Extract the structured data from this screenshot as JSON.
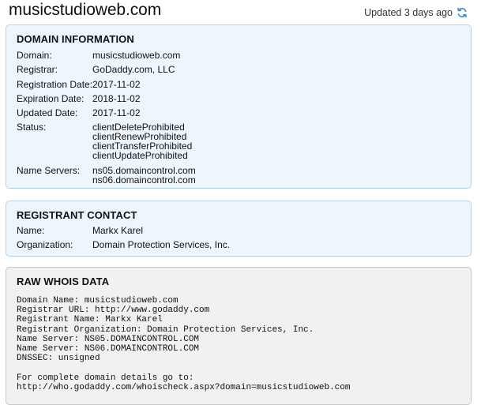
{
  "header": {
    "title": "musicstudioweb.com",
    "updated": "Updated 3 days ago",
    "refresh_icon": "refresh-icon",
    "accent": "#3a8ed6"
  },
  "domain_info": {
    "heading": "DOMAIN INFORMATION",
    "domain_label": "Domain:",
    "domain_value": "musicstudioweb.com",
    "registrar_label": "Registrar:",
    "registrar_value": "GoDaddy.com, LLC",
    "registration_label": "Registration Date:",
    "registration_value": "2017-11-02",
    "expiration_label": "Expiration Date:",
    "expiration_value": "2018-11-02",
    "updated_label": "Updated Date:",
    "updated_value": "2017-11-02",
    "status_label": "Status:",
    "status_values": [
      "clientDeleteProhibited",
      "clientRenewProhibited",
      "clientTransferProhibited",
      "clientUpdateProhibited"
    ],
    "ns_label": "Name Servers:",
    "ns_values": [
      "ns05.domaincontrol.com",
      "ns06.domaincontrol.com"
    ]
  },
  "registrant": {
    "heading": "REGISTRANT CONTACT",
    "name_label": "Name:",
    "name_value": "Markx Karel",
    "org_label": "Organization:",
    "org_value": "Domain Protection Services, Inc."
  },
  "raw": {
    "heading": "RAW WHOIS DATA",
    "lines": [
      "Domain Name: musicstudioweb.com",
      "Registrar URL: http://www.godaddy.com",
      "Registrant Name: Markx Karel",
      "Registrant Organization: Domain Protection Services, Inc.",
      "Name Server: NS05.DOMAINCONTROL.COM",
      "Name Server: NS06.DOMAINCONTROL.COM",
      "DNSSEC: unsigned",
      "",
      "For complete domain details go to:",
      "http://who.godaddy.com/whoischeck.aspx?domain=musicstudioweb.com"
    ]
  }
}
